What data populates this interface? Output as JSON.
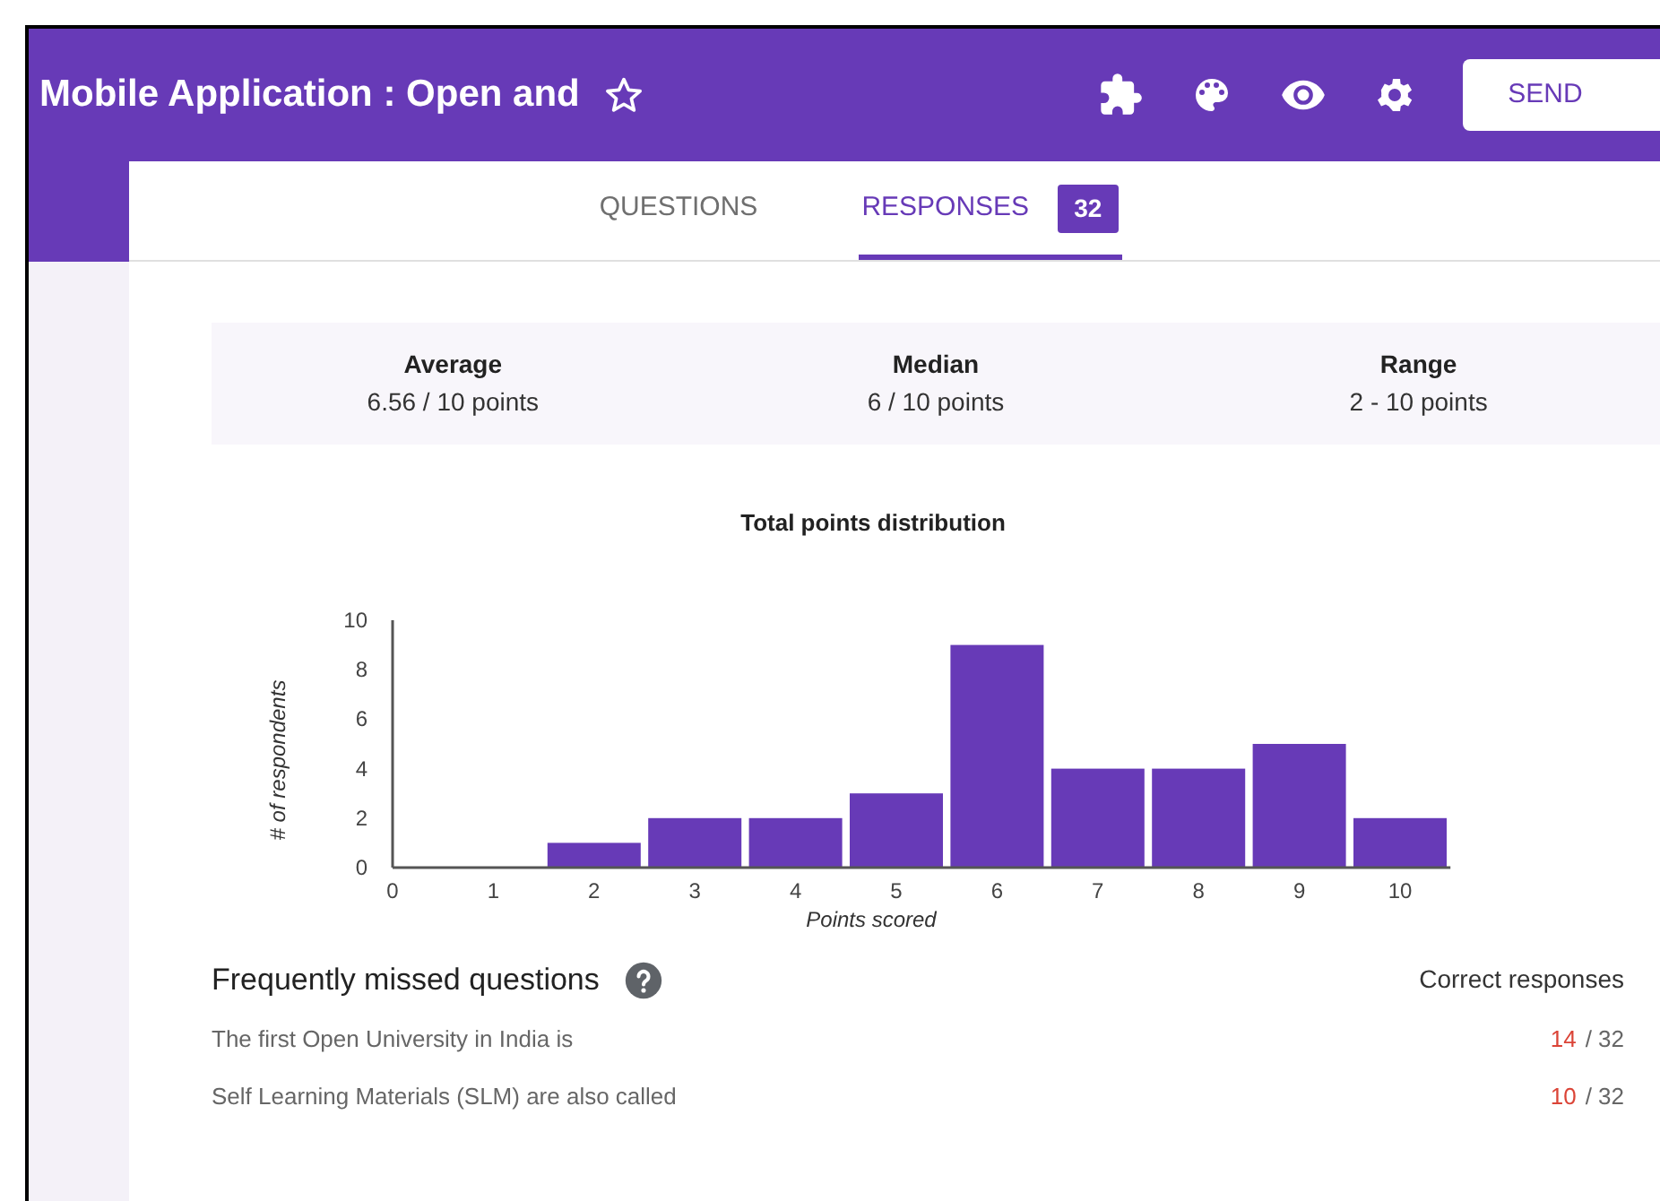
{
  "header": {
    "title": "Mobile Application : Open and",
    "starred": false,
    "send_label": "SEND"
  },
  "tabs": [
    {
      "label": "QUESTIONS",
      "selected": false
    },
    {
      "label": "RESPONSES",
      "selected": true,
      "badge": "32"
    }
  ],
  "summary": [
    {
      "label": "Average",
      "value": "6.56 / 10 points"
    },
    {
      "label": "Median",
      "value": "6 / 10 points"
    },
    {
      "label": "Range",
      "value": "2 - 10 points"
    }
  ],
  "chart": {
    "chart_data": {
      "type": "bar",
      "title": "Total points distribution",
      "xlabel": "Points scored",
      "ylabel": "# of respondents",
      "categories": [
        "0",
        "1",
        "2",
        "3",
        "4",
        "5",
        "6",
        "7",
        "8",
        "9",
        "10"
      ],
      "values": [
        0,
        0,
        1,
        2,
        2,
        3,
        9,
        4,
        4,
        5,
        2
      ],
      "ylim": [
        0,
        10
      ],
      "yticks": [
        0,
        2,
        4,
        6,
        8,
        10
      ]
    }
  },
  "missed": {
    "title": "Frequently missed questions",
    "column": "Correct responses",
    "rows": [
      {
        "question": "The first Open University in India is",
        "correct": "14",
        "total": "/ 32"
      },
      {
        "question": "Self Learning Materials (SLM) are also called",
        "correct": "10",
        "total": "/ 32"
      }
    ]
  }
}
